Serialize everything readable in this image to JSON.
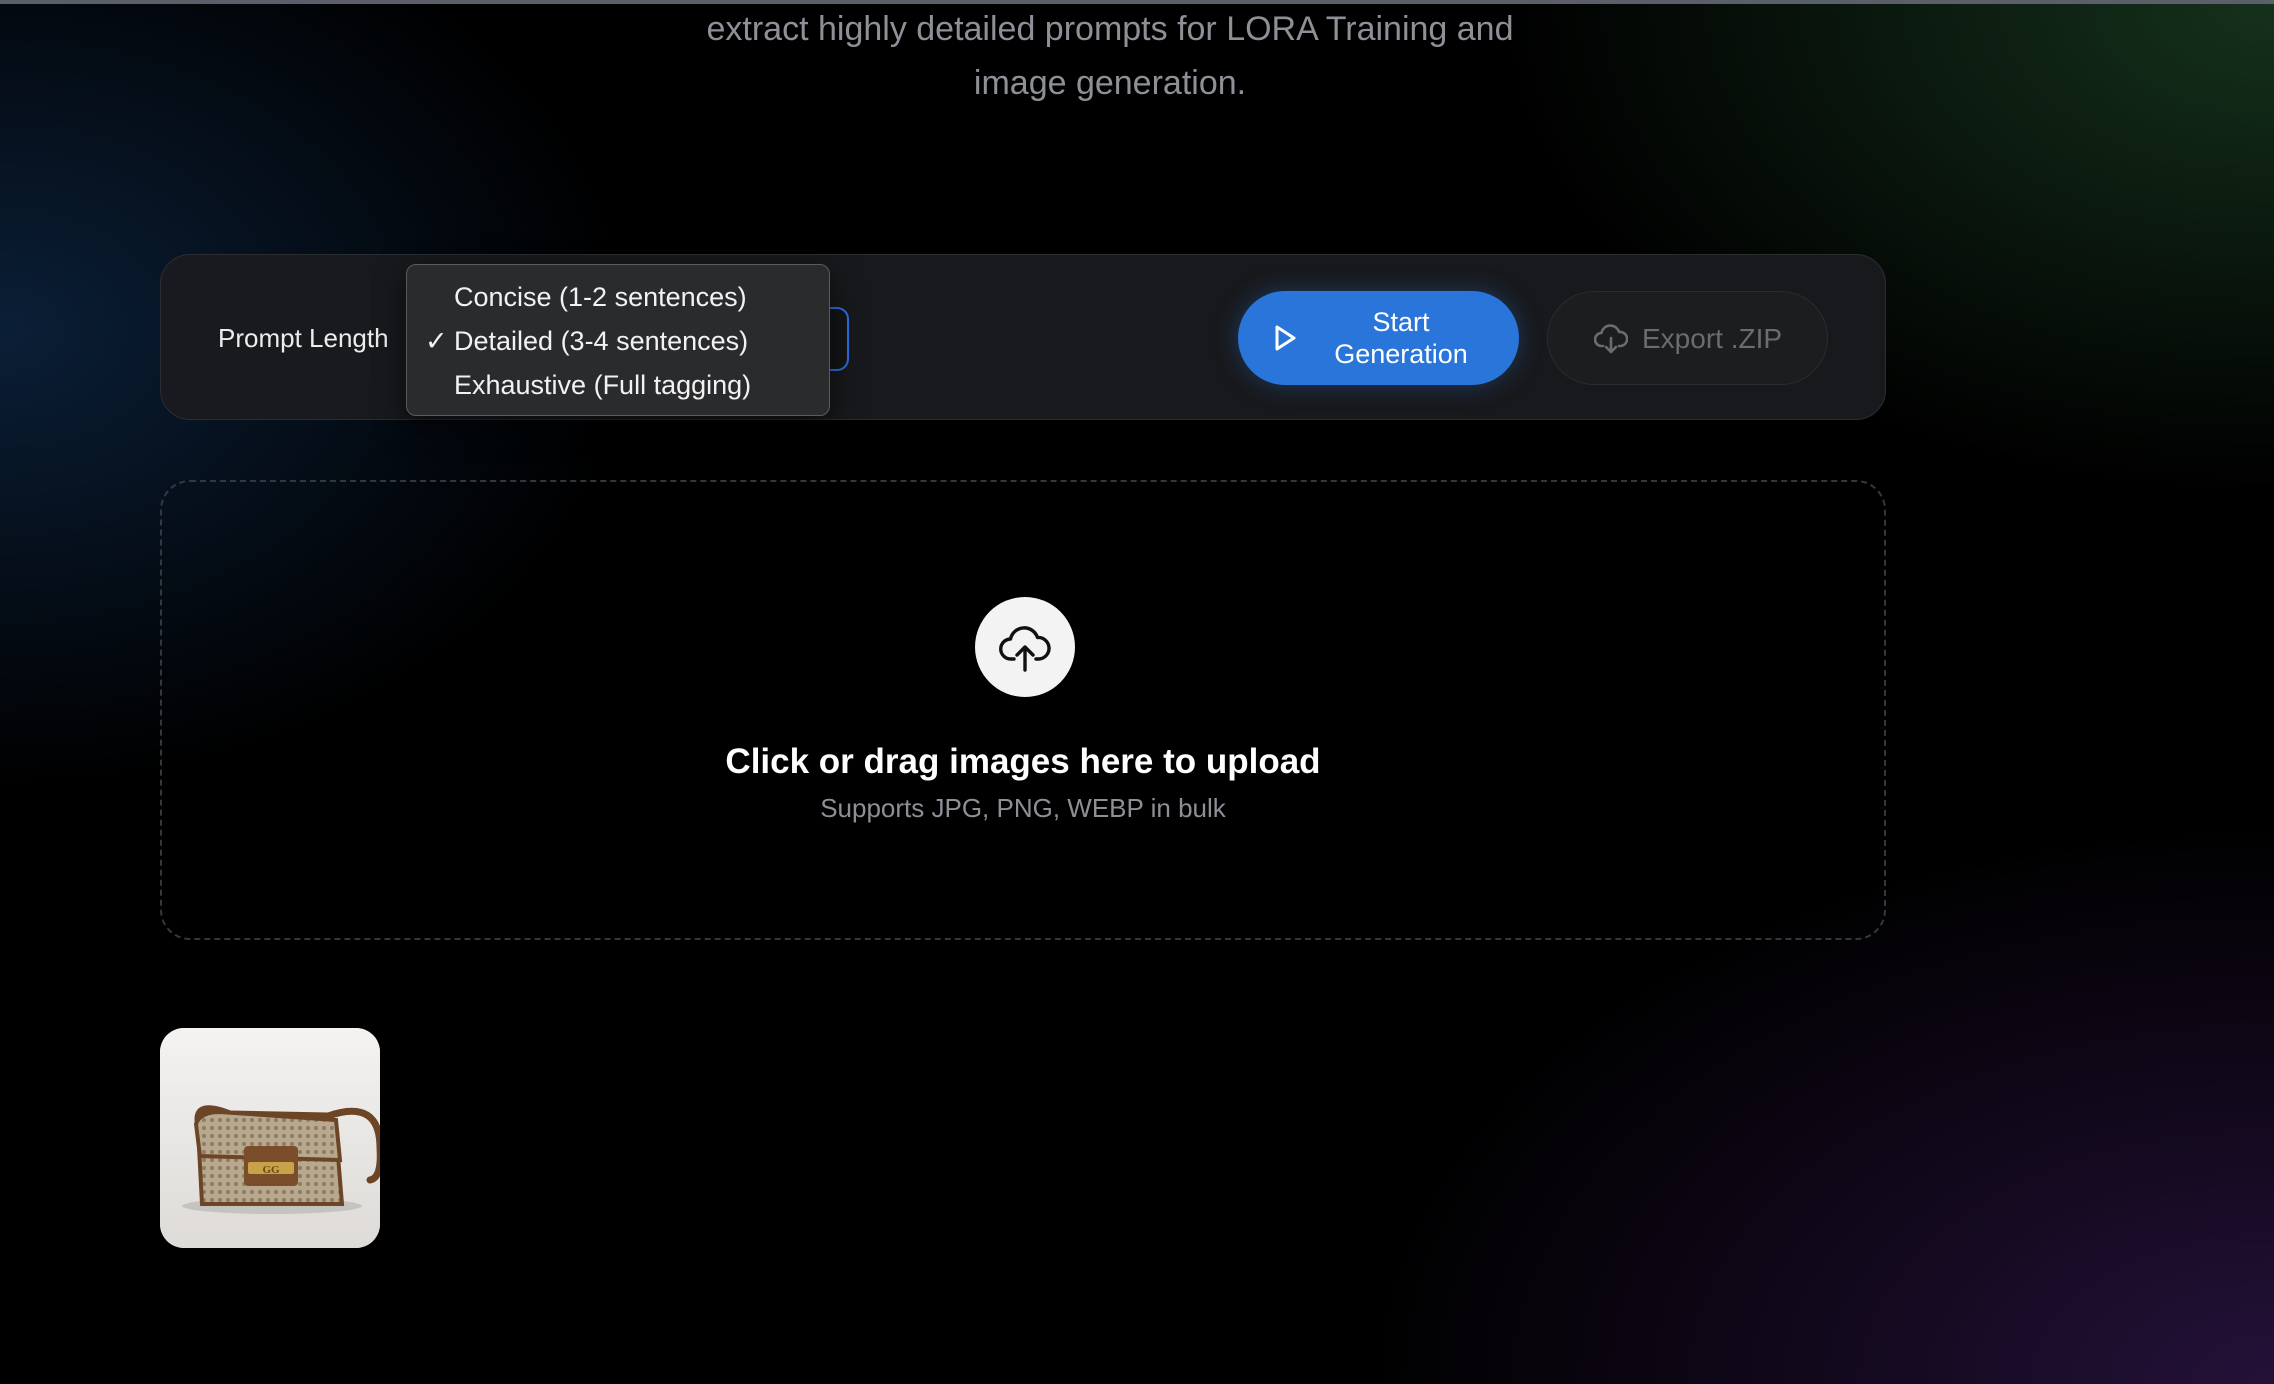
{
  "hero": {
    "subtitle_line1": "extract highly detailed prompts for LORA Training and",
    "subtitle_line2": "image generation."
  },
  "toolbar": {
    "prompt_length_label": "Prompt Length",
    "prompt_length_options": [
      {
        "label": "Concise (1-2 sentences)",
        "selected": false
      },
      {
        "label": "Detailed (3-4 sentences)",
        "selected": true
      },
      {
        "label": "Exhaustive (Full tagging)",
        "selected": false
      }
    ],
    "selected_check": "✓",
    "start_button": {
      "line1": "Start",
      "line2": "Generation",
      "icon": "play-icon"
    },
    "export_button": {
      "label": "Export .ZIP",
      "icon": "cloud-download-icon",
      "disabled": true
    }
  },
  "dropzone": {
    "icon": "cloud-upload-icon",
    "title": "Click or drag images here to upload",
    "subtitle": "Supports JPG, PNG, WEBP in bulk"
  },
  "thumbnails": [
    {
      "alt": "handbag-thumbnail",
      "logo_text": "GG"
    }
  ],
  "colors": {
    "accent": "#2a75d9",
    "background": "#000000",
    "panel": "#1a1b1e",
    "text_muted": "#8e9097"
  }
}
